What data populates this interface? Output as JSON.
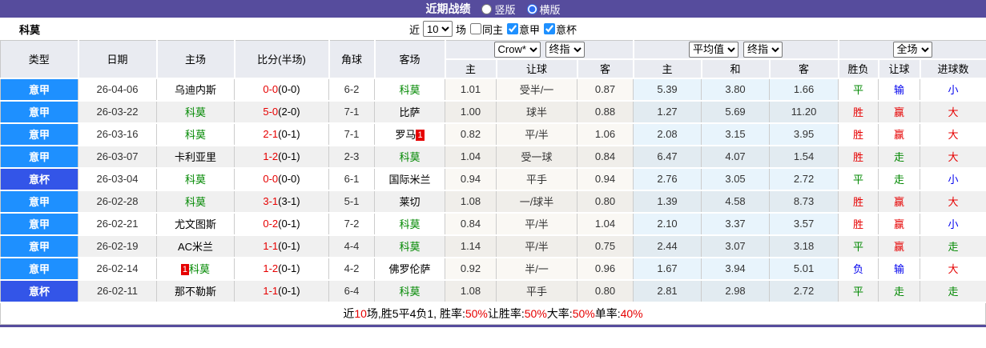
{
  "titlebar": {
    "title": "近期战绩",
    "radio_vertical": "竖版",
    "radio_horizontal": "横版",
    "selected": "横版",
    "bg_color": "#564C9D"
  },
  "controls": {
    "team": "科莫",
    "near_label": "近",
    "count_value": "10",
    "games_label": "场",
    "same_home_label": "同主",
    "league_checkbox": "意甲",
    "cup_checkbox": "意杯",
    "league_checked": true,
    "cup_checked": true,
    "same_home_checked": false
  },
  "table": {
    "headers": {
      "type": "类型",
      "date": "日期",
      "home": "主场",
      "score": "比分(半场)",
      "corner": "角球",
      "away": "客场",
      "group1": {
        "select1": "Crow*",
        "select2": "终指",
        "cols": [
          "主",
          "让球",
          "客"
        ]
      },
      "group2": {
        "select1": "平均值",
        "select2": "终指",
        "cols": [
          "主",
          "和",
          "客"
        ]
      },
      "group3": {
        "select1": "全场",
        "cols": [
          "胜负",
          "让球",
          "进球数"
        ]
      }
    },
    "league_colors": {
      "意甲": "#1E90FF",
      "意杯": "#3355E8"
    },
    "result_colors": {
      "red": "#E60000",
      "green": "#008800",
      "blue": "#0000EE"
    },
    "rows": [
      {
        "league": "意甲",
        "date": "26-04-06",
        "home": "乌迪内斯",
        "home_green": false,
        "home_badge": "",
        "score_ft": "0-0",
        "score_ht": "(0-0)",
        "corner": "6-2",
        "away": "科莫",
        "away_green": true,
        "away_badge": "",
        "crow": [
          "1.01",
          "受半/一",
          "0.87"
        ],
        "avg": [
          "5.39",
          "3.80",
          "1.66"
        ],
        "results": [
          {
            "t": "平",
            "c": "green"
          },
          {
            "t": "输",
            "c": "blue"
          },
          {
            "t": "小",
            "c": "blue"
          }
        ]
      },
      {
        "league": "意甲",
        "date": "26-03-22",
        "home": "科莫",
        "home_green": true,
        "home_badge": "",
        "score_ft": "5-0",
        "score_ht": "(2-0)",
        "corner": "7-1",
        "away": "比萨",
        "away_green": false,
        "away_badge": "",
        "crow": [
          "1.00",
          "球半",
          "0.88"
        ],
        "avg": [
          "1.27",
          "5.69",
          "11.20"
        ],
        "results": [
          {
            "t": "胜",
            "c": "red"
          },
          {
            "t": "赢",
            "c": "red"
          },
          {
            "t": "大",
            "c": "red"
          }
        ]
      },
      {
        "league": "意甲",
        "date": "26-03-16",
        "home": "科莫",
        "home_green": true,
        "home_badge": "",
        "score_ft": "2-1",
        "score_ht": "(0-1)",
        "corner": "7-1",
        "away": "罗马",
        "away_green": false,
        "away_badge": "1",
        "crow": [
          "0.82",
          "平/半",
          "1.06"
        ],
        "avg": [
          "2.08",
          "3.15",
          "3.95"
        ],
        "results": [
          {
            "t": "胜",
            "c": "red"
          },
          {
            "t": "赢",
            "c": "red"
          },
          {
            "t": "大",
            "c": "red"
          }
        ]
      },
      {
        "league": "意甲",
        "date": "26-03-07",
        "home": "卡利亚里",
        "home_green": false,
        "home_badge": "",
        "score_ft": "1-2",
        "score_ht": "(0-1)",
        "corner": "2-3",
        "away": "科莫",
        "away_green": true,
        "away_badge": "",
        "crow": [
          "1.04",
          "受一球",
          "0.84"
        ],
        "avg": [
          "6.47",
          "4.07",
          "1.54"
        ],
        "results": [
          {
            "t": "胜",
            "c": "red"
          },
          {
            "t": "走",
            "c": "green"
          },
          {
            "t": "大",
            "c": "red"
          }
        ]
      },
      {
        "league": "意杯",
        "date": "26-03-04",
        "home": "科莫",
        "home_green": true,
        "home_badge": "",
        "score_ft": "0-0",
        "score_ht": "(0-0)",
        "corner": "6-1",
        "away": "国际米兰",
        "away_green": false,
        "away_badge": "",
        "crow": [
          "0.94",
          "平手",
          "0.94"
        ],
        "avg": [
          "2.76",
          "3.05",
          "2.72"
        ],
        "results": [
          {
            "t": "平",
            "c": "green"
          },
          {
            "t": "走",
            "c": "green"
          },
          {
            "t": "小",
            "c": "blue"
          }
        ]
      },
      {
        "league": "意甲",
        "date": "26-02-28",
        "home": "科莫",
        "home_green": true,
        "home_badge": "",
        "score_ft": "3-1",
        "score_ht": "(3-1)",
        "corner": "5-1",
        "away": "莱切",
        "away_green": false,
        "away_badge": "",
        "crow": [
          "1.08",
          "一/球半",
          "0.80"
        ],
        "avg": [
          "1.39",
          "4.58",
          "8.73"
        ],
        "results": [
          {
            "t": "胜",
            "c": "red"
          },
          {
            "t": "赢",
            "c": "red"
          },
          {
            "t": "大",
            "c": "red"
          }
        ]
      },
      {
        "league": "意甲",
        "date": "26-02-21",
        "home": "尤文图斯",
        "home_green": false,
        "home_badge": "",
        "score_ft": "0-2",
        "score_ht": "(0-1)",
        "corner": "7-2",
        "away": "科莫",
        "away_green": true,
        "away_badge": "",
        "crow": [
          "0.84",
          "平/半",
          "1.04"
        ],
        "avg": [
          "2.10",
          "3.37",
          "3.57"
        ],
        "results": [
          {
            "t": "胜",
            "c": "red"
          },
          {
            "t": "赢",
            "c": "red"
          },
          {
            "t": "小",
            "c": "blue"
          }
        ]
      },
      {
        "league": "意甲",
        "date": "26-02-19",
        "home": "AC米兰",
        "home_green": false,
        "home_badge": "",
        "score_ft": "1-1",
        "score_ht": "(0-1)",
        "corner": "4-4",
        "away": "科莫",
        "away_green": true,
        "away_badge": "",
        "crow": [
          "1.14",
          "平/半",
          "0.75"
        ],
        "avg": [
          "2.44",
          "3.07",
          "3.18"
        ],
        "results": [
          {
            "t": "平",
            "c": "green"
          },
          {
            "t": "赢",
            "c": "red"
          },
          {
            "t": "走",
            "c": "green"
          }
        ]
      },
      {
        "league": "意甲",
        "date": "26-02-14",
        "home": "科莫",
        "home_green": true,
        "home_badge": "1",
        "score_ft": "1-2",
        "score_ht": "(0-1)",
        "corner": "4-2",
        "away": "佛罗伦萨",
        "away_green": false,
        "away_badge": "",
        "crow": [
          "0.92",
          "半/一",
          "0.96"
        ],
        "avg": [
          "1.67",
          "3.94",
          "5.01"
        ],
        "results": [
          {
            "t": "负",
            "c": "blue"
          },
          {
            "t": "输",
            "c": "blue"
          },
          {
            "t": "大",
            "c": "red"
          }
        ]
      },
      {
        "league": "意杯",
        "date": "26-02-11",
        "home": "那不勒斯",
        "home_green": false,
        "home_badge": "",
        "score_ft": "1-1",
        "score_ht": "(0-1)",
        "corner": "6-4",
        "away": "科莫",
        "away_green": true,
        "away_badge": "",
        "crow": [
          "1.08",
          "平手",
          "0.80"
        ],
        "avg": [
          "2.81",
          "2.98",
          "2.72"
        ],
        "results": [
          {
            "t": "平",
            "c": "green"
          },
          {
            "t": "走",
            "c": "green"
          },
          {
            "t": "走",
            "c": "green"
          }
        ]
      }
    ]
  },
  "footer": {
    "segments": [
      {
        "text": "近",
        "color": "#000"
      },
      {
        "text": "10",
        "color": "#E60000"
      },
      {
        "text": "场,胜5平4负1, 胜率:",
        "color": "#000"
      },
      {
        "text": "50%",
        "color": "#E60000"
      },
      {
        "text": " 让胜率:",
        "color": "#000"
      },
      {
        "text": "50%",
        "color": "#E60000"
      },
      {
        "text": " 大率:",
        "color": "#000"
      },
      {
        "text": "50%",
        "color": "#E60000"
      },
      {
        "text": " 单率:",
        "color": "#000"
      },
      {
        "text": "40%",
        "color": "#E60000"
      }
    ]
  }
}
